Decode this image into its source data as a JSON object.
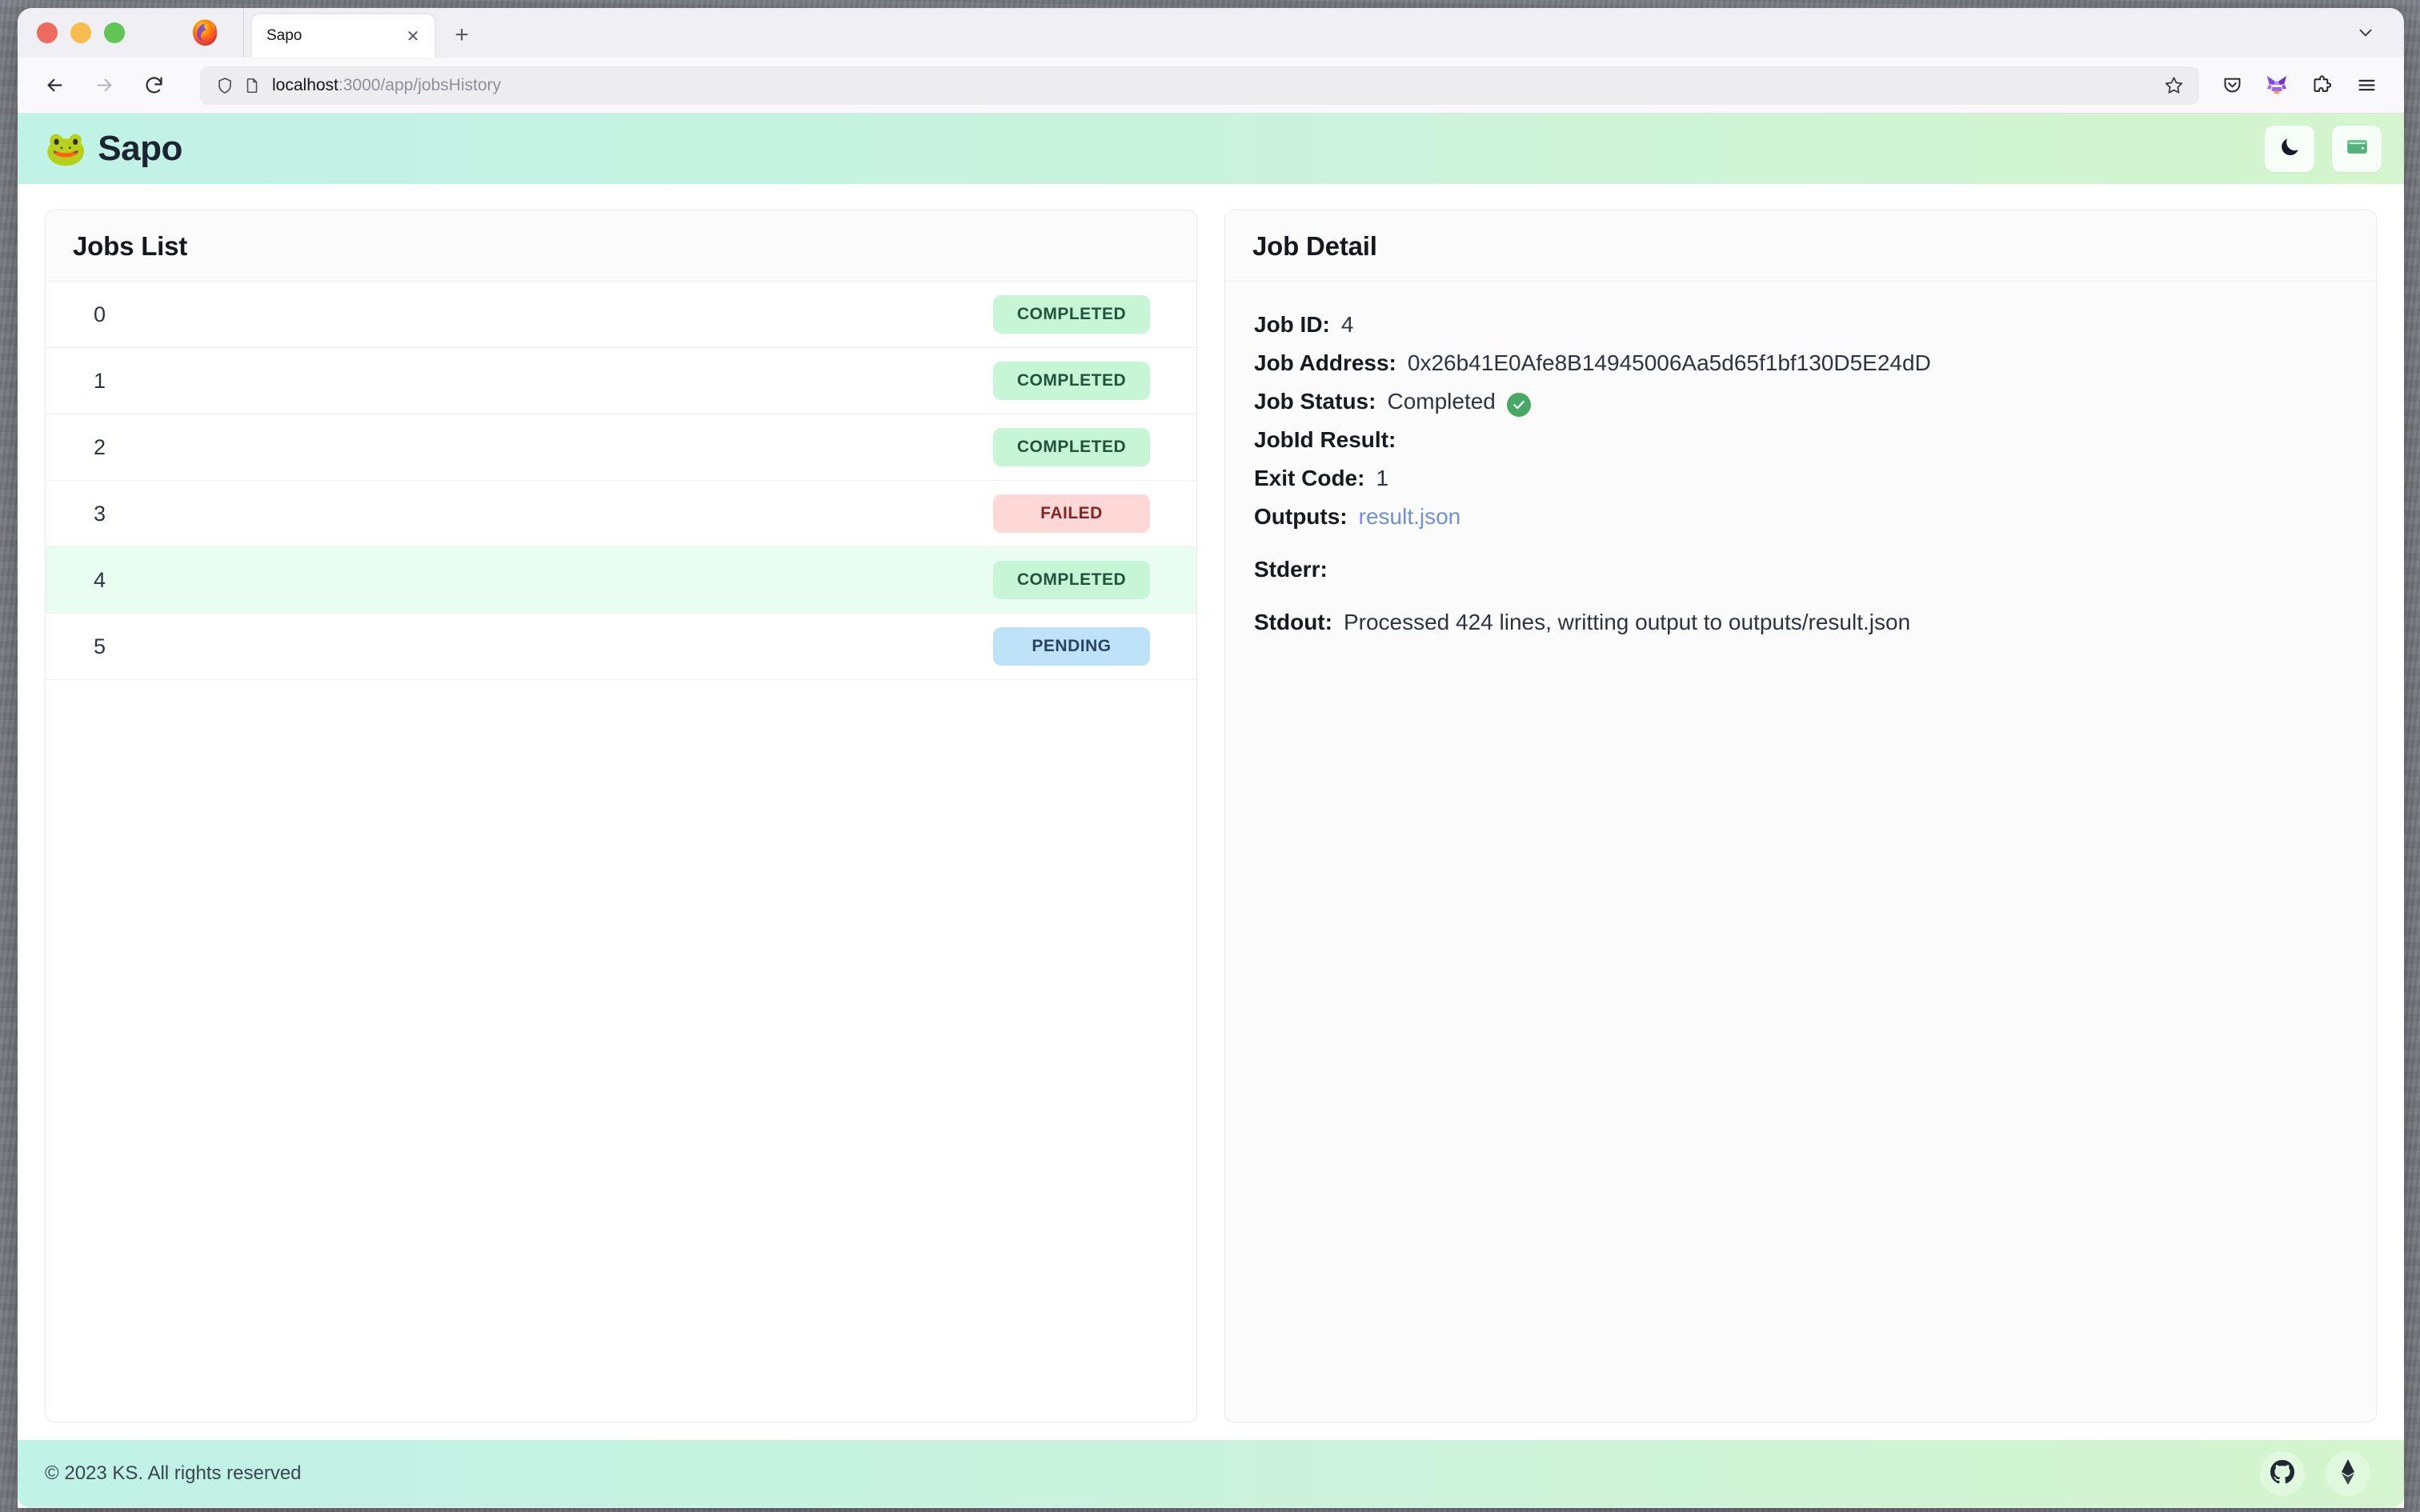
{
  "browser": {
    "tab": {
      "title": "Sapo",
      "close_label": "✕"
    },
    "new_tab_label": "+",
    "url": {
      "host": "localhost",
      "path": ":3000/app/jobsHistory"
    },
    "icons": {
      "back": "back-arrow-icon",
      "forward": "forward-arrow-icon",
      "reload": "reload-icon",
      "shield": "shield-icon",
      "page": "page-icon",
      "bookmark": "star-icon",
      "pocket": "pocket-icon",
      "metamask": "metamask-fox-icon",
      "extensions": "puzzle-piece-icon",
      "menu": "hamburger-menu-icon",
      "tab_list": "chevron-down-icon",
      "firefox": "firefox-logo-icon"
    }
  },
  "app": {
    "brand": {
      "emoji": "🐸",
      "name": "Sapo"
    },
    "header_buttons": [
      {
        "name": "dark-mode-toggle",
        "icon": "moon-icon"
      },
      {
        "name": "wallet-button",
        "icon": "wallet-icon"
      }
    ]
  },
  "jobs_panel": {
    "title": "Jobs List",
    "rows": [
      {
        "id": "0",
        "status": "COMPLETED",
        "variant": "completed",
        "selected": false
      },
      {
        "id": "1",
        "status": "COMPLETED",
        "variant": "completed",
        "selected": false
      },
      {
        "id": "2",
        "status": "COMPLETED",
        "variant": "completed",
        "selected": false
      },
      {
        "id": "3",
        "status": "FAILED",
        "variant": "failed",
        "selected": false
      },
      {
        "id": "4",
        "status": "COMPLETED",
        "variant": "completed",
        "selected": true
      },
      {
        "id": "5",
        "status": "PENDING",
        "variant": "pending",
        "selected": false
      }
    ]
  },
  "detail_panel": {
    "title": "Job Detail",
    "labels": {
      "job_id": "Job ID:",
      "job_address": "Job Address:",
      "job_status": "Job Status:",
      "jobid_result": "JobId Result:",
      "exit_code": "Exit Code:",
      "outputs": "Outputs:",
      "stderr": "Stderr:",
      "stdout": "Stdout:"
    },
    "values": {
      "job_id": "4",
      "job_address": "0x26b41E0Afe8B14945006Aa5d65f1bf130D5E24dD",
      "job_status": "Completed",
      "jobid_result": "",
      "exit_code": "1",
      "outputs": "result.json",
      "stderr": "",
      "stdout": "Processed 424 lines, writting output to outputs/result.json"
    }
  },
  "footer": {
    "copyright": "© 2023 KS. All rights reserved",
    "social": [
      {
        "name": "github-link",
        "icon": "github-icon"
      },
      {
        "name": "ethereum-link",
        "icon": "ethereum-icon"
      }
    ]
  },
  "colors": {
    "header_gradient_start": "#c0f2e6",
    "header_gradient_end": "#d4f5cd",
    "badge_completed_bg": "#c6f6d5",
    "badge_completed_fg": "#22543d",
    "badge_failed_bg": "#fed7d7",
    "badge_failed_fg": "#822727",
    "badge_pending_bg": "#bee3f8",
    "badge_pending_fg": "#2a4365",
    "selected_row_bg": "#e9fdf3",
    "link": "#6f91d1",
    "status_check": "#48a868"
  }
}
